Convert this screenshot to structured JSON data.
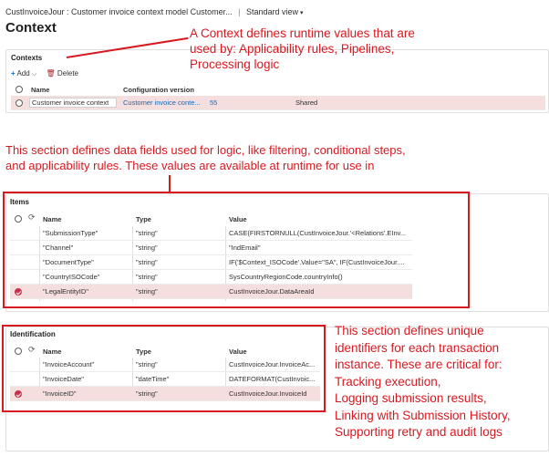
{
  "header": {
    "breadcrumb_path": "CustInvoiceJour : Customer invoice context model Customer...",
    "view_label": "Standard view",
    "page_title": "Context"
  },
  "contexts": {
    "title": "Contexts",
    "toolbar": {
      "add_label": "Add",
      "delete_label": "Delete"
    },
    "columns": {
      "name": "Name",
      "config_version": "Configuration version"
    },
    "row": {
      "name": "Customer invoice context",
      "config_version": "Customer invoice conte...",
      "version_number": "55",
      "shared": "Shared"
    }
  },
  "items": {
    "title": "Items",
    "columns": {
      "name": "Name",
      "type": "Type",
      "value": "Value"
    },
    "rows": [
      {
        "name": "\"SubmissionType\"",
        "type": "\"string\"",
        "value": "CASE(FIRSTORNULL(CustInvoiceJour.'<Relations'.EInv..."
      },
      {
        "name": "\"Channel\"",
        "type": "\"string\"",
        "value": "\"IndEmail\""
      },
      {
        "name": "\"DocumentType\"",
        "type": "\"string\"",
        "value": "IF('$Context_ISOCode'.Value=\"SA\", IF(CustInvoiceJour...."
      },
      {
        "name": "\"CountryISOCode\"",
        "type": "\"string\"",
        "value": "SysCountryRegionCode.countryInfo()"
      },
      {
        "name": "\"LegalEntityID\"",
        "type": "\"string\"",
        "value": "CustInvoiceJour.DataAreaId"
      }
    ]
  },
  "identification": {
    "title": "Identification",
    "columns": {
      "name": "Name",
      "type": "Type",
      "value": "Value"
    },
    "rows": [
      {
        "name": "\"InvoiceAccount\"",
        "type": "\"string\"",
        "value": "CustInvoiceJour.InvoiceAc..."
      },
      {
        "name": "\"InvoiceDate\"",
        "type": "\"dateTime\"",
        "value": "DATEFORMAT(CustInvoic..."
      },
      {
        "name": "\"InvoiceID\"",
        "type": "\"string\"",
        "value": "CustInvoiceJour.InvoiceId"
      }
    ]
  },
  "annotations": {
    "context": [
      "A Context defines runtime values that are",
      "used by: Applicability rules, Pipelines,",
      "Processing logic"
    ],
    "items": [
      "This section defines data fields used for logic, like filtering, conditional steps,",
      "and applicability rules. These values are available at runtime for use in"
    ],
    "identification": [
      "This section defines unique",
      "identifiers for each transaction",
      "instance. These are critical for:",
      "Tracking execution,",
      "Logging submission results,",
      "Linking with Submission History,",
      "Supporting retry and audit logs"
    ]
  },
  "colors": {
    "annotation_red": "#d71920",
    "selected_row": "#f5dede",
    "link_blue": "#0f6cbd"
  }
}
